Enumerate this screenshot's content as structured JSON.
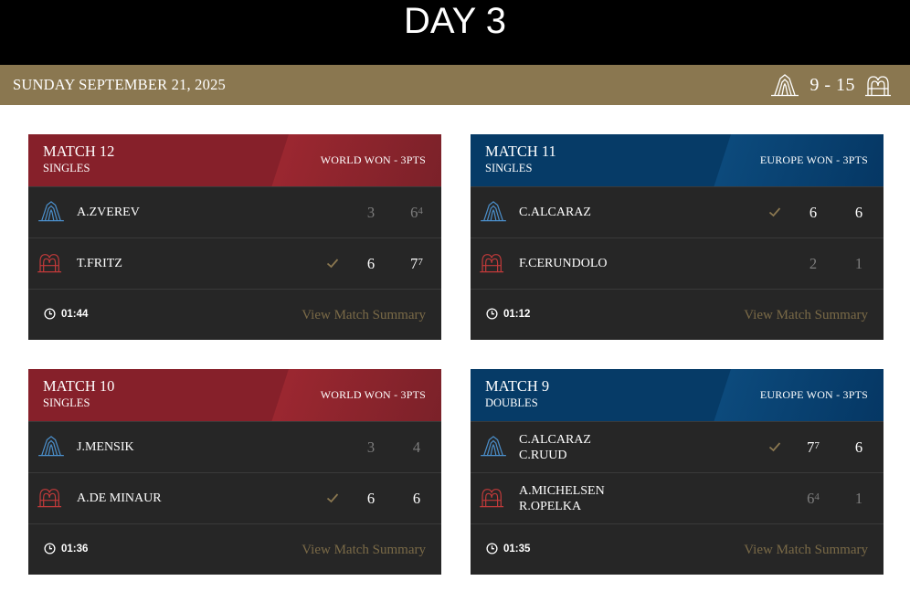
{
  "header": {
    "title": "DAY 3"
  },
  "date_bar": {
    "date": "SUNDAY SEPTEMBER 21, 2025",
    "score": "9 - 15",
    "left_icon": "team-world-logo-icon",
    "right_icon": "team-europe-logo-icon"
  },
  "colors": {
    "world": "#86202a",
    "europe": "#063b67",
    "gold": "#8a7750"
  },
  "matches": [
    {
      "number": "MATCH 12",
      "type": "SINGLES",
      "result": "WORLD WON - 3PTS",
      "team": "world",
      "players": [
        {
          "name": "A.ZVEREV",
          "team_icon": "team-europe-logo-icon",
          "winner": false,
          "sets": [
            {
              "score": "3",
              "tb": "",
              "won": false
            },
            {
              "score": "6",
              "tb": "4",
              "won": false
            }
          ]
        },
        {
          "name": "T.FRITZ",
          "team_icon": "team-world-logo-icon",
          "winner": true,
          "sets": [
            {
              "score": "6",
              "tb": "",
              "won": true
            },
            {
              "score": "7",
              "tb": "7",
              "won": true
            }
          ]
        }
      ],
      "duration": "01:44",
      "link": "View Match Summary"
    },
    {
      "number": "MATCH 11",
      "type": "SINGLES",
      "result": "EUROPE WON - 3PTS",
      "team": "europe",
      "players": [
        {
          "name": "C.ALCARAZ",
          "team_icon": "team-europe-logo-icon",
          "winner": true,
          "sets": [
            {
              "score": "6",
              "tb": "",
              "won": true
            },
            {
              "score": "6",
              "tb": "",
              "won": true
            }
          ]
        },
        {
          "name": "F.CERUNDOLO",
          "team_icon": "team-world-logo-icon",
          "winner": false,
          "sets": [
            {
              "score": "2",
              "tb": "",
              "won": false
            },
            {
              "score": "1",
              "tb": "",
              "won": false
            }
          ]
        }
      ],
      "duration": "01:12",
      "link": "View Match Summary"
    },
    {
      "number": "MATCH 10",
      "type": "SINGLES",
      "result": "WORLD WON - 3PTS",
      "team": "world",
      "players": [
        {
          "name": "J.MENSIK",
          "team_icon": "team-europe-logo-icon",
          "winner": false,
          "sets": [
            {
              "score": "3",
              "tb": "",
              "won": false
            },
            {
              "score": "4",
              "tb": "",
              "won": false
            }
          ]
        },
        {
          "name": "A.DE MINAUR",
          "team_icon": "team-world-logo-icon",
          "winner": true,
          "sets": [
            {
              "score": "6",
              "tb": "",
              "won": true
            },
            {
              "score": "6",
              "tb": "",
              "won": true
            }
          ]
        }
      ],
      "duration": "01:36",
      "link": "View Match Summary"
    },
    {
      "number": "MATCH 9",
      "type": "DOUBLES",
      "result": "EUROPE WON - 3PTS",
      "team": "europe",
      "players": [
        {
          "name": "C.ALCARAZ",
          "name2": "C.RUUD",
          "team_icon": "team-europe-logo-icon",
          "winner": true,
          "sets": [
            {
              "score": "7",
              "tb": "7",
              "won": true
            },
            {
              "score": "6",
              "tb": "",
              "won": true
            }
          ]
        },
        {
          "name": "A.MICHELSEN",
          "name2": "R.OPELKA",
          "team_icon": "team-world-logo-icon",
          "winner": false,
          "sets": [
            {
              "score": "6",
              "tb": "4",
              "won": false
            },
            {
              "score": "1",
              "tb": "",
              "won": false
            }
          ]
        }
      ],
      "duration": "01:35",
      "link": "View Match Summary"
    }
  ]
}
